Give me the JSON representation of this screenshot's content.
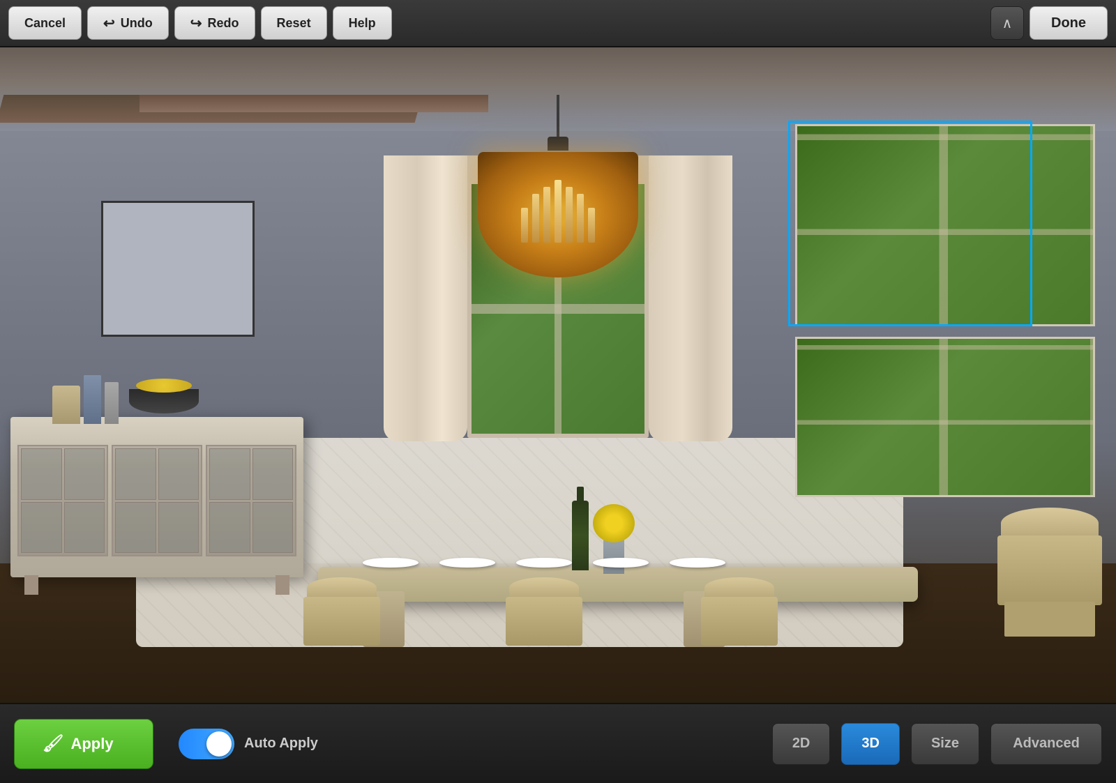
{
  "toolbar": {
    "cancel_label": "Cancel",
    "undo_label": "Undo",
    "redo_label": "Redo",
    "reset_label": "Reset",
    "help_label": "Help",
    "done_label": "Done",
    "collapse_icon": "∧"
  },
  "bottom": {
    "apply_label": "Apply",
    "auto_apply_label": "Auto Apply",
    "view_2d_label": "2D",
    "view_3d_label": "3D",
    "size_label": "Size",
    "advanced_label": "Advanced",
    "toggle_state": "on"
  },
  "scene": {
    "selection_active": true
  }
}
